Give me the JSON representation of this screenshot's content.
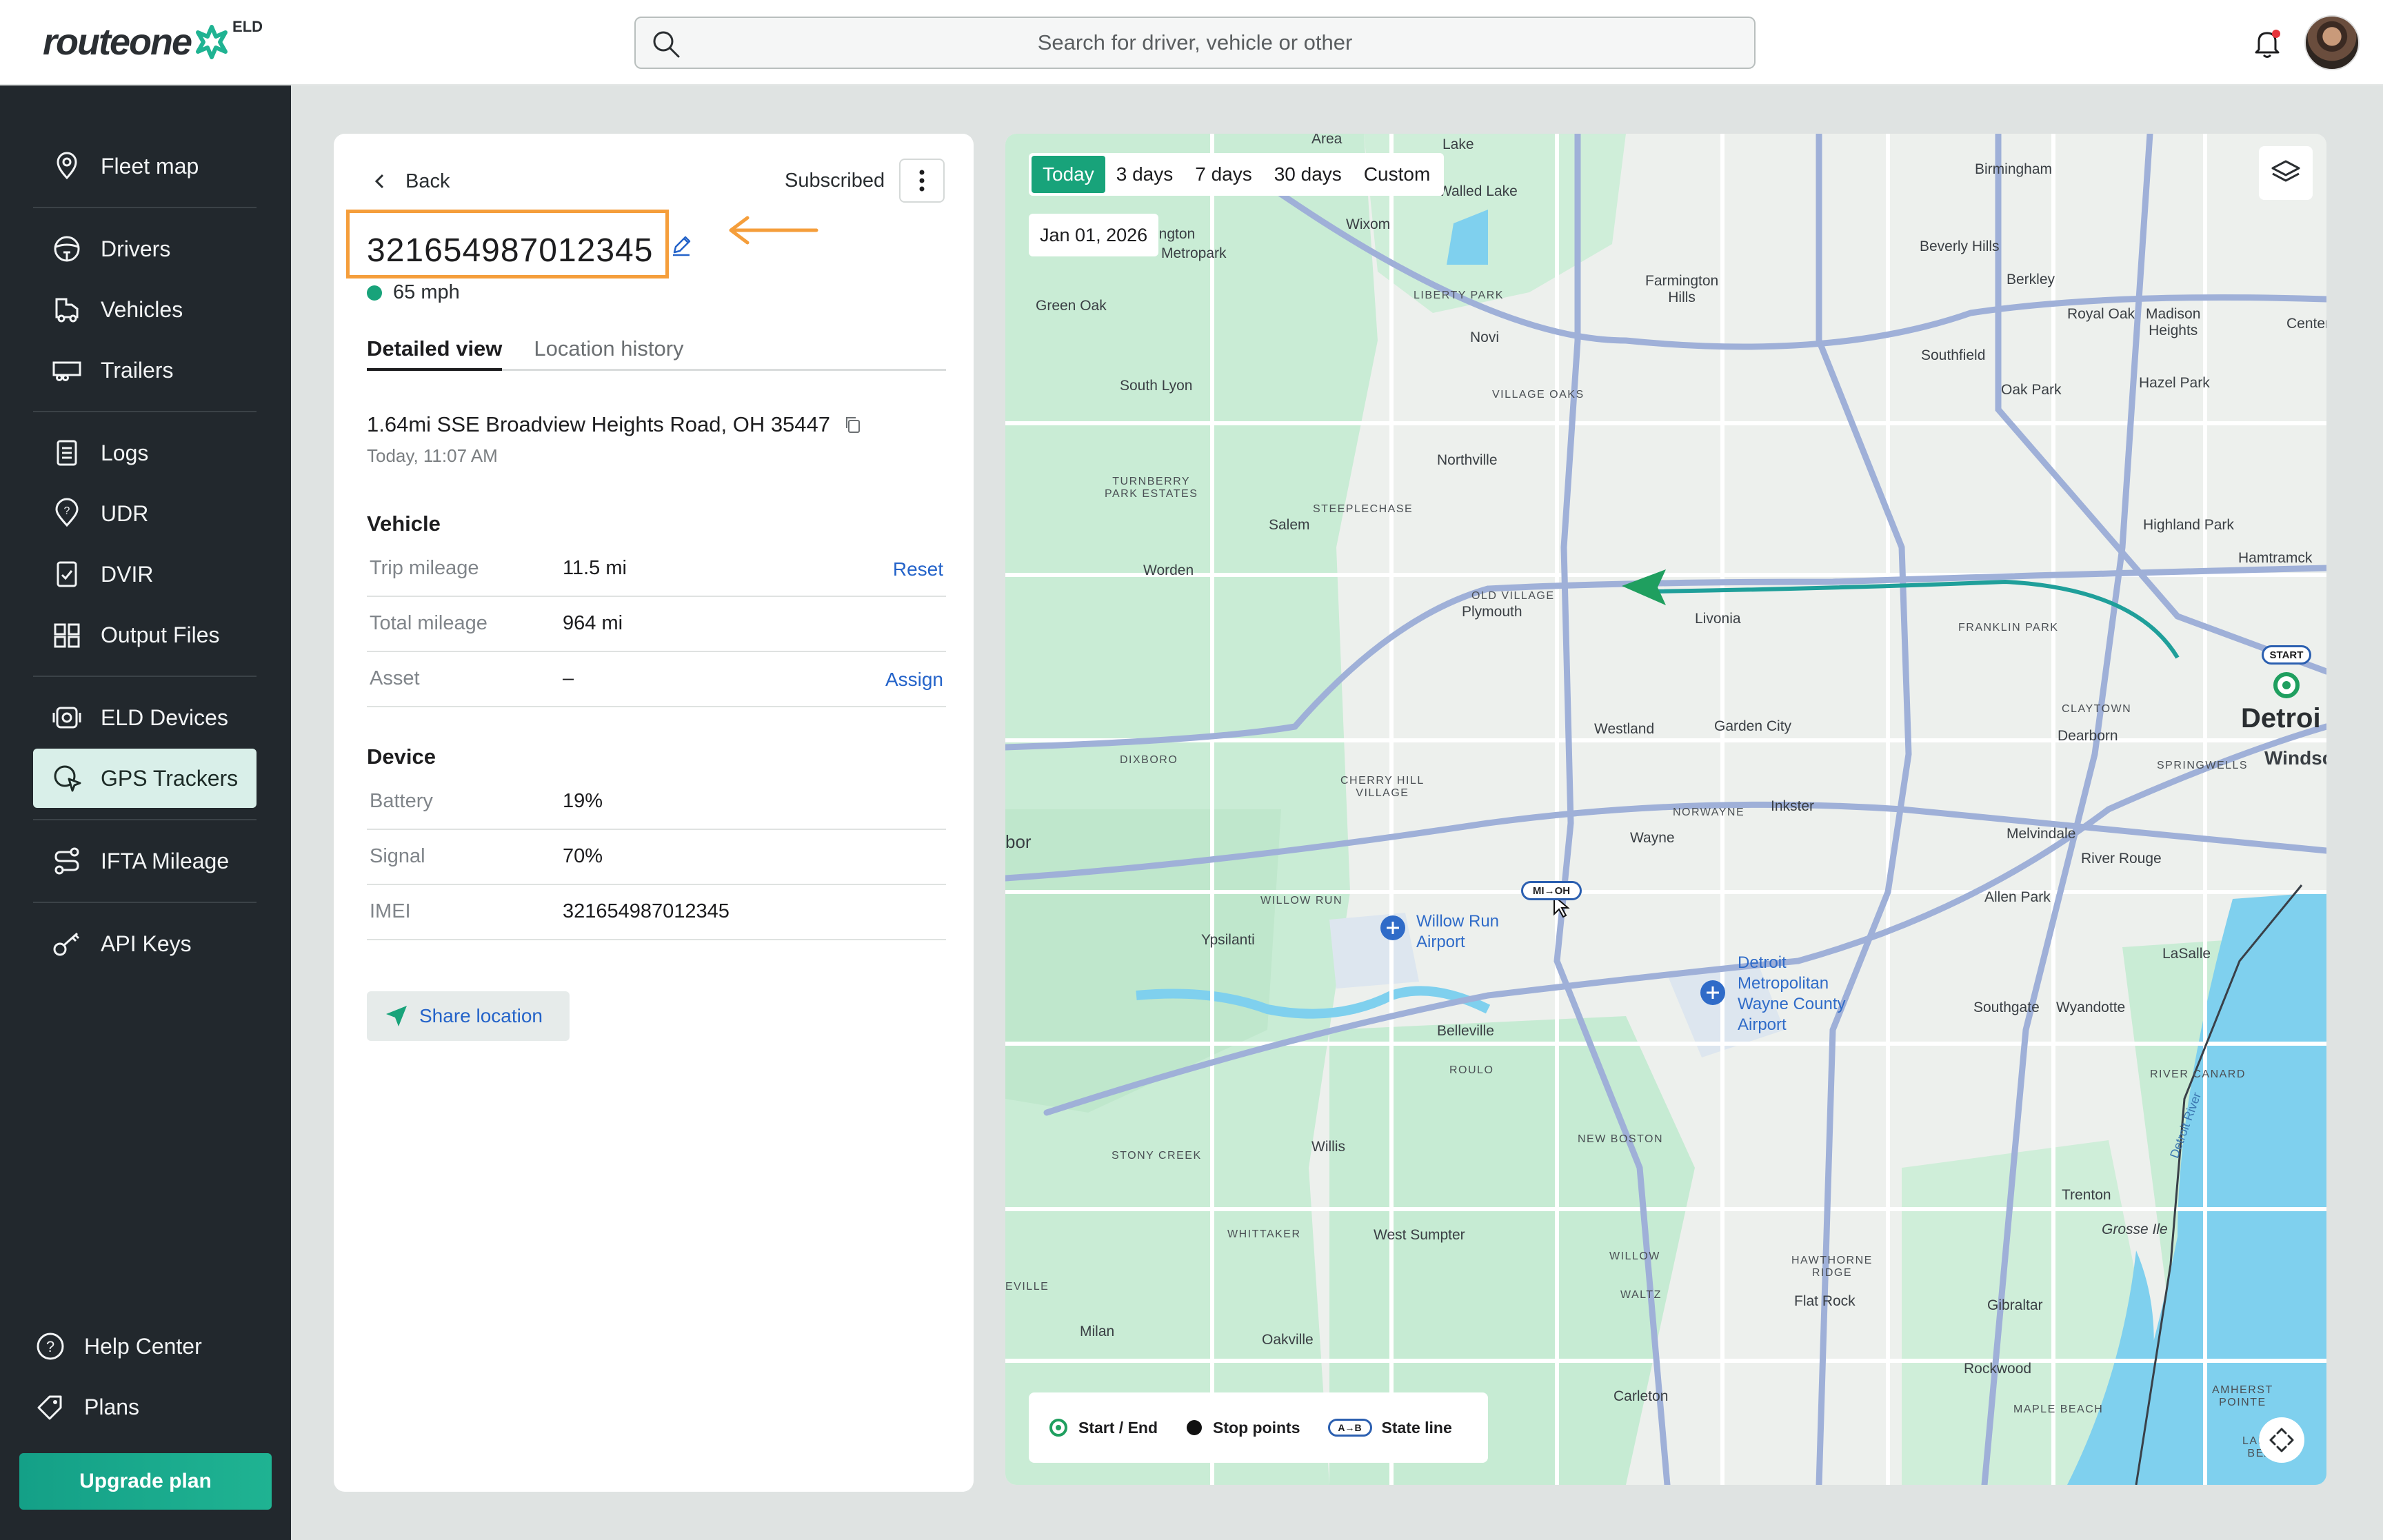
{
  "brand": {
    "name": "routeone",
    "badge": "ELD"
  },
  "search": {
    "placeholder": "Search for driver, vehicle or other"
  },
  "sidebar": {
    "items": [
      {
        "label": "Fleet map",
        "icon": "pin-icon"
      },
      {
        "label": "Drivers",
        "icon": "steering-wheel-icon"
      },
      {
        "label": "Vehicles",
        "icon": "truck-icon"
      },
      {
        "label": "Trailers",
        "icon": "trailer-icon"
      },
      {
        "label": "Logs",
        "icon": "clipboard-icon"
      },
      {
        "label": "UDR",
        "icon": "location-question-icon"
      },
      {
        "label": "DVIR",
        "icon": "checklist-icon"
      },
      {
        "label": "Output Files",
        "icon": "files-icon"
      },
      {
        "label": "ELD Devices",
        "icon": "device-icon"
      },
      {
        "label": "GPS Trackers",
        "icon": "gps-tracker-icon"
      },
      {
        "label": "IFTA Mileage",
        "icon": "route-icon"
      },
      {
        "label": "API Keys",
        "icon": "key-icon"
      }
    ],
    "help": "Help Center",
    "plans": "Plans",
    "upgrade": "Upgrade plan",
    "active_index": 9
  },
  "panel": {
    "back": "Back",
    "status": "Subscribed",
    "tracker_id": "321654987012345",
    "speed": "65 mph",
    "tabs": [
      "Detailed view",
      "Location history"
    ],
    "address": "1.64mi SSE Broadview Heights Road, OH 35447",
    "timestamp": "Today, 11:07 AM",
    "vehicle": {
      "heading": "Vehicle",
      "trip_mileage": {
        "label": "Trip mileage",
        "value": "11.5 mi",
        "action": "Reset"
      },
      "total_mileage": {
        "label": "Total mileage",
        "value": "964 mi"
      },
      "asset": {
        "label": "Asset",
        "value": "–",
        "action": "Assign"
      }
    },
    "device": {
      "heading": "Device",
      "battery": {
        "label": "Battery",
        "value": "19%"
      },
      "signal": {
        "label": "Signal",
        "value": "70%"
      },
      "imei": {
        "label": "IMEI",
        "value": "321654987012345"
      }
    },
    "share": "Share location"
  },
  "map": {
    "ranges": [
      "Today",
      "3 days",
      "7 days",
      "30 days",
      "Custom"
    ],
    "active_range": "Today",
    "date": "Jan 01, 2026",
    "legend": {
      "start_end": "Start / End",
      "stops": "Stop points",
      "state_line": "State line",
      "state_icon": "A→B"
    },
    "state_badge": "MI→OH",
    "start_badge": "START",
    "places": {
      "birmingham": "Birmingham",
      "lake": "Lake",
      "walled_lake": "Walled Lake",
      "area": "Area",
      "wixom": "Wixom",
      "ington": "ington",
      "metropark": "Metropark",
      "green_oak": "Green Oak",
      "liberty_park": "LIBERTY PARK",
      "farmington_hills": "Farmington\nHills",
      "beverly_hills": "Beverly Hills",
      "berkley": "Berkley",
      "royal_oak": "Royal Oak",
      "madison_heights": "Madison\nHeights",
      "center": "Center",
      "novi": "Novi",
      "southfield": "Southfield",
      "oak_park": "Oak Park",
      "hazel_park": "Hazel Park",
      "south_lyon": "South Lyon",
      "village_oaks": "VILLAGE OAKS",
      "northville": "Northville",
      "turnberry": "TURNBERRY\nPARK ESTATES",
      "steeplechase": "STEEPLECHASE",
      "salem": "Salem",
      "highland_park": "Highland Park",
      "hamtramck": "Hamtramck",
      "worden": "Worden",
      "old_village": "OLD VILLAGE",
      "plymouth": "Plymouth",
      "livonia": "Livonia",
      "franklin_park": "FRANKLIN PARK",
      "claytown": "CLAYTOWN",
      "detroit": "Detroi",
      "windsor": "Windsc",
      "westland": "Westland",
      "garden_city": "Garden City",
      "dearborn": "Dearborn",
      "dixboro": "DIXBORO",
      "springwells": "SPRINGWELLS",
      "cherry_hill": "CHERRY HILL\nVILLAGE",
      "norwayne": "NORWAYNE",
      "inkster": "Inkster",
      "wayne": "Wayne",
      "melvindale": "Melvindale",
      "river_rouge": "River Rouge",
      "arbor": "bor",
      "willow_run": "WILLOW RUN",
      "ypsilanti": "Ypsilanti",
      "willow_run_airport": "Willow Run\nAirport",
      "allen_park": "Allen Park",
      "lasalle": "LaSalle",
      "dtw_airport": "Detroit\nMetropolitan\nWayne County\nAirport",
      "southgate": "Southgate",
      "wyandotte": "Wyandotte",
      "belleville": "Belleville",
      "roulo": "ROULO",
      "river_canard": "RIVER CANARD",
      "new_boston": "NEW BOSTON",
      "stony_creek": "STONY CREEK",
      "willis": "Willis",
      "detroit_river": "Detroit River",
      "trenton": "Trenton",
      "grosse_ile": "Grosse Ile",
      "whittaker": "WHITTAKER",
      "west_sumpter": "West Sumpter",
      "willow": "WILLOW",
      "hawthorne_ridge": "HAWTHORNE\nRIDGE",
      "ville": "EVILLE",
      "waltz": "WALTZ",
      "flat_rock": "Flat Rock",
      "gibraltar": "Gibraltar",
      "milan": "Milan",
      "oakville": "Oakville",
      "carleton": "Carleton",
      "rockwood": "Rockwood",
      "amherst_pointe": "AMHERST\nPOINTE",
      "maple_beach": "MAPLE BEACH",
      "lakewood_beach": "LAKEWO\nBEACH"
    },
    "colors": {
      "land": "#edf0ed",
      "park": "#c9ecd5",
      "water": "#7fd0ee",
      "highway": "#9fb0d8",
      "accent": "#18a37a"
    }
  },
  "callout_color": "#f59e3b"
}
